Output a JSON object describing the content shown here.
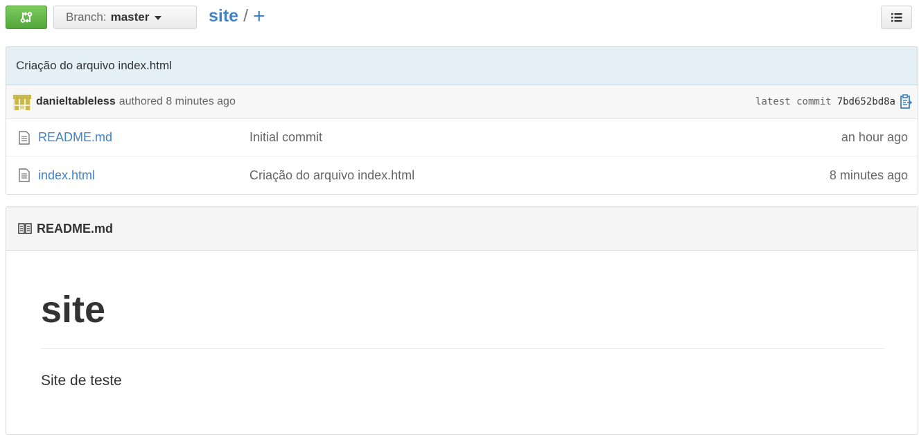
{
  "topbar": {
    "branch_label": "Branch:",
    "branch_value": "master",
    "repo_name": "site",
    "separator": "/",
    "add_file": "+"
  },
  "commit": {
    "message": "Criação do arquivo index.html",
    "author": "danieltableless",
    "authored_text": "authored 8 minutes ago",
    "latest_label": "latest commit",
    "sha": "7bd652bd8a"
  },
  "files": [
    {
      "name": "README.md",
      "message": "Initial commit",
      "age": "an hour ago"
    },
    {
      "name": "index.html",
      "message": "Criação do arquivo index.html",
      "age": "8 minutes ago"
    }
  ],
  "readme": {
    "filename": "README.md",
    "heading": "site",
    "paragraph": "Site de teste"
  },
  "icons": {
    "compare": "git-compare-icon",
    "menu": "list-icon",
    "avatar": "pixel-avatar",
    "clipboard": "clipboard-icon",
    "file": "file-text-icon",
    "book": "book-icon"
  },
  "colors": {
    "accent": "#4183c4",
    "compare_button": "#60b044",
    "commit_bar": "#e5f0f6"
  }
}
